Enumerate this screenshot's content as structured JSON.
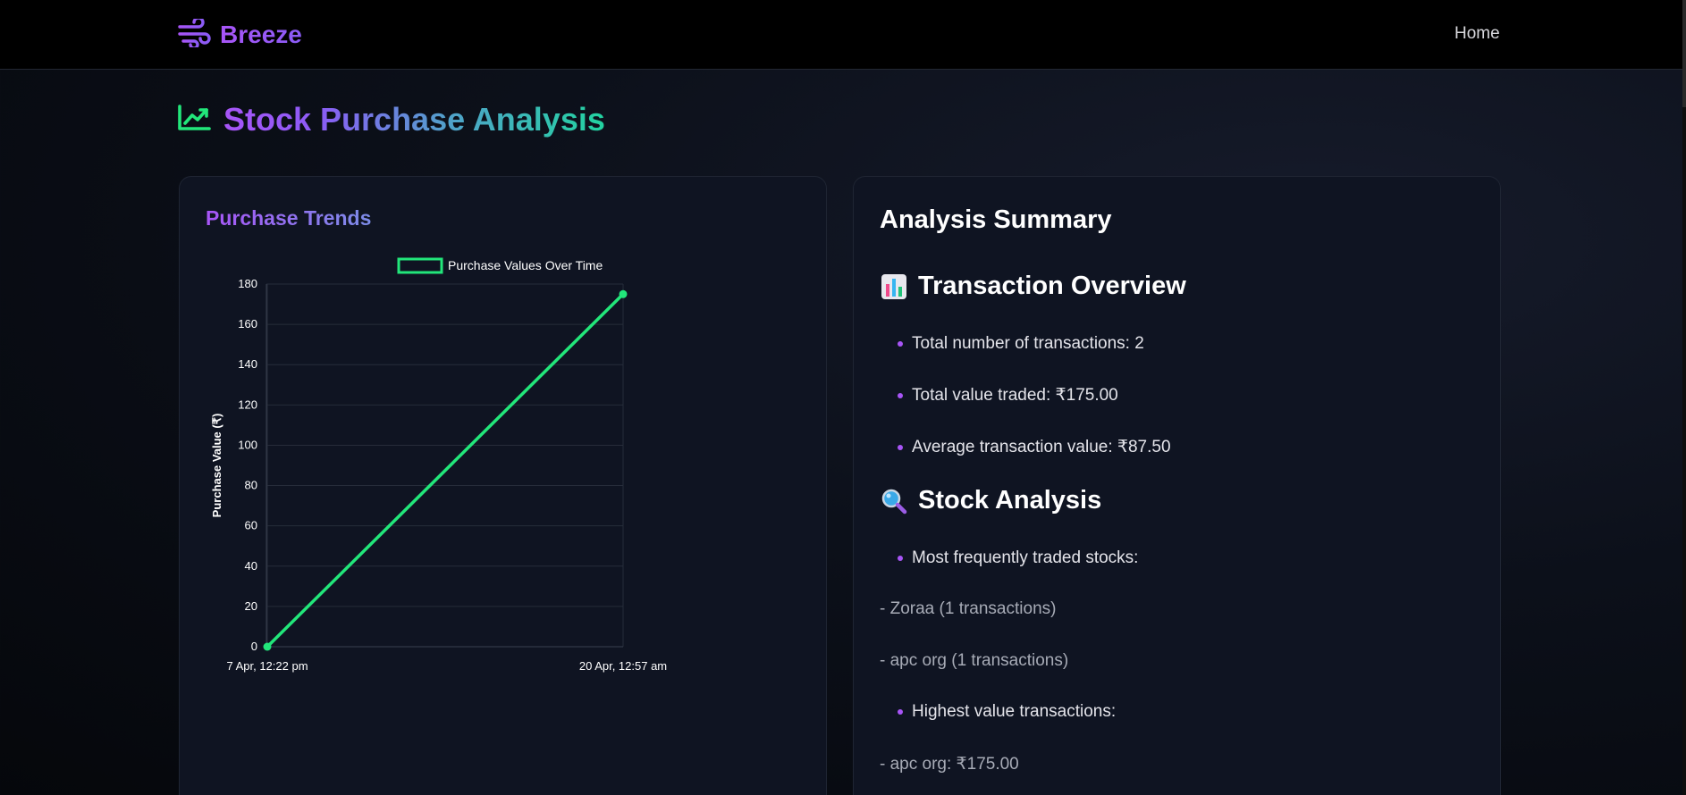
{
  "navbar": {
    "brand": "Breeze",
    "home_label": "Home"
  },
  "page": {
    "title": "Stock Purchase Analysis"
  },
  "trends_card": {
    "heading": "Purchase Trends"
  },
  "chart_data": {
    "type": "line",
    "x": [
      "7 Apr, 12:22 pm",
      "20 Apr, 12:57 am"
    ],
    "series": [
      {
        "name": "Purchase Values Over Time",
        "values": [
          0,
          175
        ],
        "color": "#22e67a"
      }
    ],
    "xlabel": "",
    "ylabel": "Purchase Value (₹)",
    "ylim": [
      0,
      180
    ],
    "yticks": [
      0,
      20,
      40,
      60,
      80,
      100,
      120,
      140,
      160,
      180
    ],
    "grid": true,
    "legend": "top-center"
  },
  "summary": {
    "title": "Analysis Summary",
    "transaction_overview": {
      "heading": "Transaction Overview",
      "items": [
        "Total number of transactions: 2",
        "Total value traded: ₹175.00",
        "Average transaction value: ₹87.50"
      ]
    },
    "stock_analysis": {
      "heading": "Stock Analysis",
      "frequent_label": "Most frequently traded stocks:",
      "frequent_items": [
        "- Zoraa (1 transactions)",
        "- apc org (1 transactions)"
      ],
      "highest_label": "Highest value transactions:",
      "highest_items": [
        "- apc org: ₹175.00"
      ]
    }
  },
  "colors": {
    "accent_purple": "#a855f7",
    "accent_green": "#22e67a",
    "card_bg": "#0f1422"
  },
  "icons": {
    "brand": "wind-icon",
    "title": "chart-line-icon",
    "overview": "bar-chart-emoji-icon",
    "analysis": "magnifier-emoji-icon"
  }
}
